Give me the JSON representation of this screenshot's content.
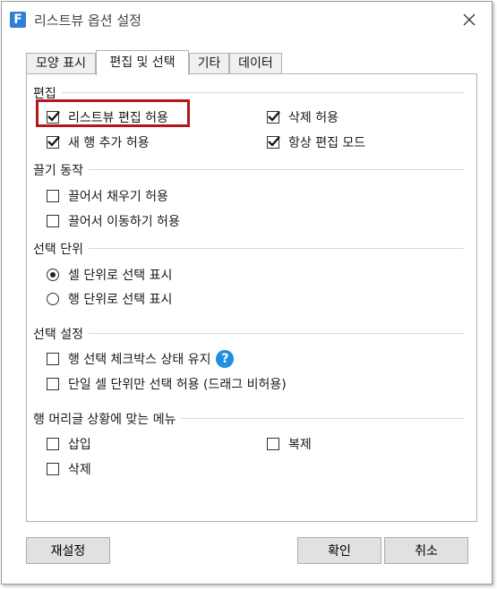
{
  "window": {
    "title": "리스트뷰 옵션 설정"
  },
  "tabs": [
    {
      "label": "모양 표시"
    },
    {
      "label": "편집 및 선택"
    },
    {
      "label": "기타"
    },
    {
      "label": "데이터"
    }
  ],
  "groups": {
    "edit": {
      "title": "편집",
      "items": [
        {
          "label": "리스트뷰 편집 허용",
          "checked": true
        },
        {
          "label": "삭제 허용",
          "checked": true
        },
        {
          "label": "새 행 추가 허용",
          "checked": true
        },
        {
          "label": "항상 편집 모드",
          "checked": true
        }
      ]
    },
    "drag": {
      "title": "끌기 동작",
      "items": [
        {
          "label": "끌어서 채우기 허용",
          "checked": false
        },
        {
          "label": "끌어서 이동하기 허용",
          "checked": false
        }
      ]
    },
    "unit": {
      "title": "선택 단위",
      "items": [
        {
          "label": "셀 단위로 선택 표시",
          "selected": true
        },
        {
          "label": "행 단위로 선택 표시",
          "selected": false
        }
      ]
    },
    "select": {
      "title": "선택 설정",
      "items": [
        {
          "label": "행 선택 체크박스 상태 유지",
          "checked": false
        },
        {
          "label": "단일 셀 단위만 선택 허용 (드래그 비허용)",
          "checked": false
        }
      ]
    },
    "menu": {
      "title": "행 머리글 상황에 맞는 메뉴",
      "items": [
        {
          "label": "삽입",
          "checked": false
        },
        {
          "label": "복제",
          "checked": false
        },
        {
          "label": "삭제",
          "checked": false
        }
      ]
    }
  },
  "help_icon": "?",
  "buttons": {
    "reset": "재설정",
    "ok": "확인",
    "cancel": "취소"
  },
  "colors": {
    "highlight": "#b3161d",
    "help": "#1f8fe0",
    "app_icon": "#2f7fd6"
  }
}
